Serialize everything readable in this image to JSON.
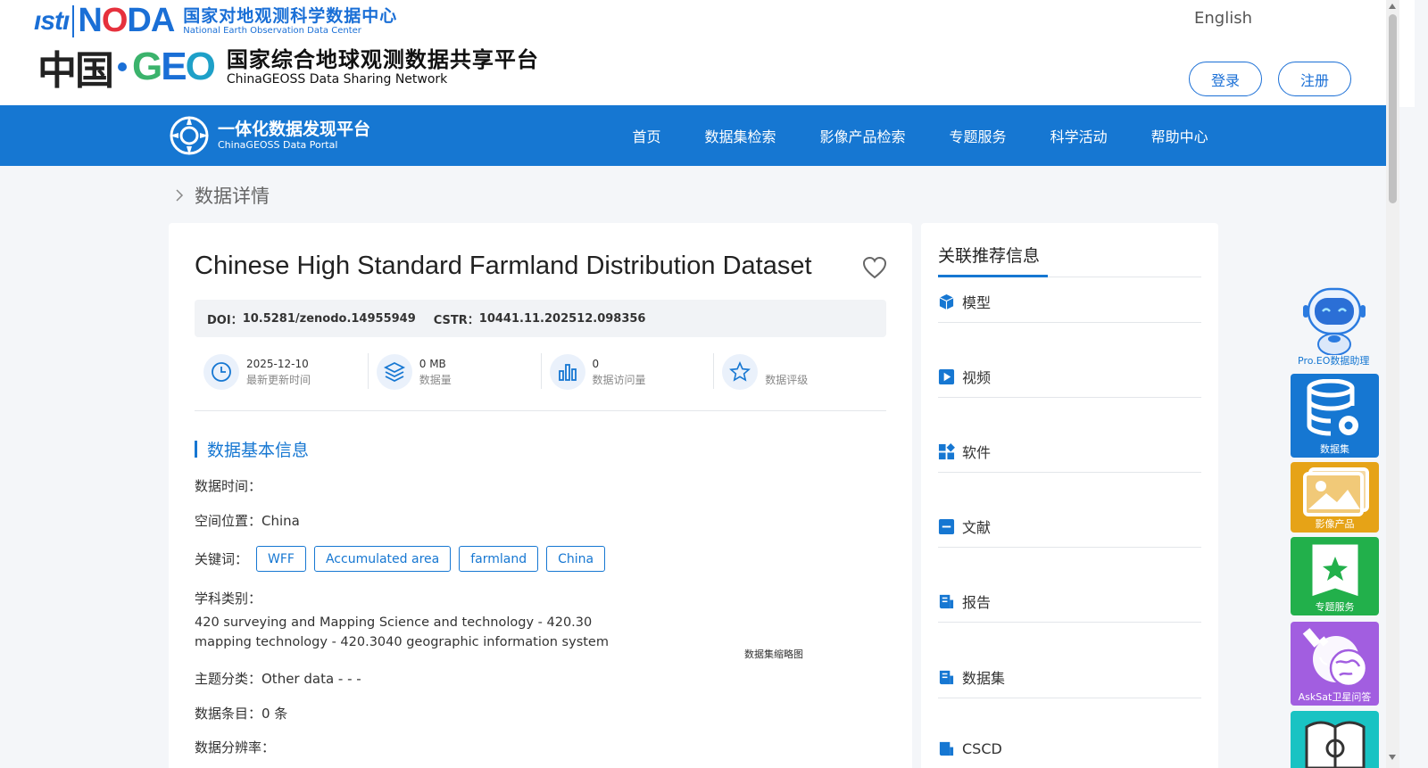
{
  "header": {
    "noda_cn": "国家对地观测科学数据中心",
    "noda_en": "National Earth Observation Data Center",
    "geo_cn": "国家综合地球观测数据共享平台",
    "geo_en": "ChinaGEOSS Data Sharing Network",
    "language": "English",
    "login": "登录",
    "register": "注册"
  },
  "nav": {
    "portal_cn": "一体化数据发现平台",
    "portal_en": "ChinaGEOSS Data Portal",
    "items": [
      "首页",
      "数据集检索",
      "影像产品检索",
      "专题服务",
      "科学活动",
      "帮助中心"
    ]
  },
  "breadcrumb": "数据详情",
  "dataset": {
    "title": "Chinese High Standard Farmland Distribution Dataset",
    "doi_label": "DOI：",
    "doi": "10.5281/zenodo.14955949",
    "cstr_label": "CSTR：",
    "cstr": "10441.11.202512.098356",
    "stats": [
      {
        "value": "2025-12-10",
        "label": "最新更新时间"
      },
      {
        "value": "0 MB",
        "label": "数据量"
      },
      {
        "value": "0",
        "label": "数据访问量"
      },
      {
        "value": "",
        "label": "数据评级"
      }
    ],
    "section_title": "数据基本信息",
    "data_time": "数据时间：",
    "spatial": "空间位置：China",
    "keywords_label": "关键词：",
    "keywords": [
      "WFF",
      "Accumulated area",
      "farmland",
      "China"
    ],
    "subject_label": "学科类别：",
    "subject_value": "420 surveying and Mapping Science and technology - 420.30 mapping technology - 420.3040 geographic information system",
    "theme": "主题分类：Other data - - -",
    "entries": "数据条目：0 条",
    "resolution": "数据分辨率：",
    "thumb_caption": "数据集缩略图"
  },
  "sidebar": {
    "title": "关联推荐信息",
    "items": [
      "模型",
      "视频",
      "软件",
      "文献",
      "报告",
      "数据集",
      "CSCD"
    ]
  },
  "float_tools": {
    "robot": "Pro.EO数据助理",
    "items": [
      "数据集",
      "影像产品",
      "专题服务",
      "AskSat卫星问答"
    ]
  },
  "colors": {
    "primary": "#1677d2",
    "tool_dataset": "#1677d2",
    "tool_image": "#e6a317",
    "tool_topic": "#22b04b",
    "tool_asksat": "#a25ee0",
    "tool_book": "#19c3c3"
  }
}
